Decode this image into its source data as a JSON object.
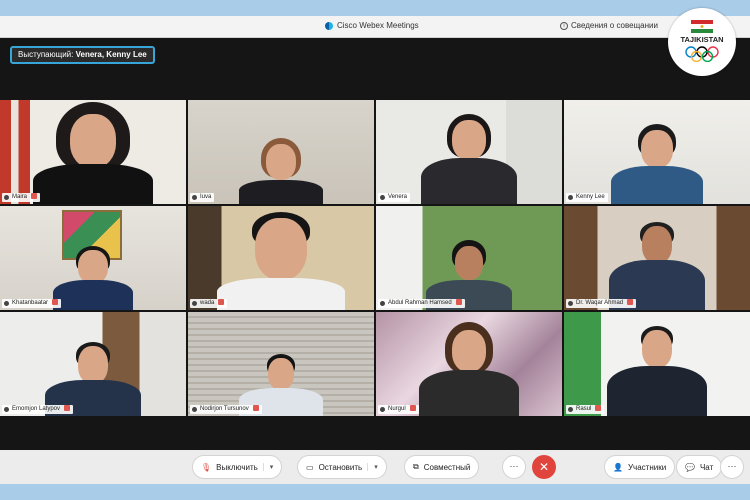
{
  "window": {
    "title": "Cisco Webex Meetings",
    "meeting_info": "Сведения о совещании"
  },
  "speaker": {
    "prefix": "Выступающий:",
    "names": "Venera,  Kenny Lee"
  },
  "logo": {
    "text": "TAJIKISTAN"
  },
  "participants": [
    {
      "name": "Maira",
      "muted": true
    },
    {
      "name": "Iuva",
      "muted": false
    },
    {
      "name": "Venera",
      "muted": false
    },
    {
      "name": "Kenny Lee",
      "muted": false
    },
    {
      "name": "Khatanbaatar",
      "muted": true
    },
    {
      "name": "wada",
      "muted": true
    },
    {
      "name": "Abdul Rahman Hamsed",
      "muted": true
    },
    {
      "name": "Dr. Waqar Ahmad",
      "muted": true
    },
    {
      "name": "Emomjon Latypov",
      "muted": true
    },
    {
      "name": "Nodirjon Tursunov",
      "muted": true
    },
    {
      "name": "Nurgul",
      "muted": true
    },
    {
      "name": "Rasul",
      "muted": true
    }
  ],
  "controls": {
    "mute": "Выключить",
    "stop_video": "Остановить",
    "share": "Совместный",
    "more": "···",
    "end": "✕",
    "participants": "Участники",
    "chat": "Чат",
    "more_right": "···"
  },
  "colors": {
    "active_border": "#3db4e6",
    "end_button": "#e0443c",
    "banner_border": "#38a5d8"
  }
}
